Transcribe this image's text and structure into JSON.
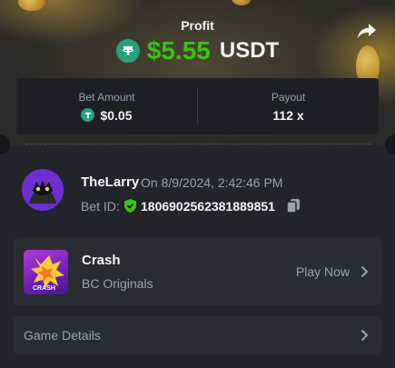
{
  "header": {
    "profit_label": "Profit",
    "profit_amount": "$5.55",
    "profit_currency": "USDT",
    "share_icon": "share-arrow-icon"
  },
  "stats": {
    "bet_amount_label": "Bet Amount",
    "bet_amount_value": "$0.05",
    "payout_label": "Payout",
    "payout_value": "112 x"
  },
  "user": {
    "name": "TheLarry",
    "date": "On 8/9/2024, 2:42:46 PM",
    "bet_id_label": "Bet ID:",
    "bet_id": "1806902562381889851"
  },
  "game": {
    "name": "Crash",
    "provider": "BC Originals",
    "play_label": "Play Now",
    "thumb_text": "CRASH"
  },
  "details": {
    "label": "Game Details"
  },
  "colors": {
    "profit_green": "#3bc117",
    "tether_green": "#26a17b",
    "muted_text": "#9aa3ad",
    "panel_bg": "#2a2c31"
  }
}
